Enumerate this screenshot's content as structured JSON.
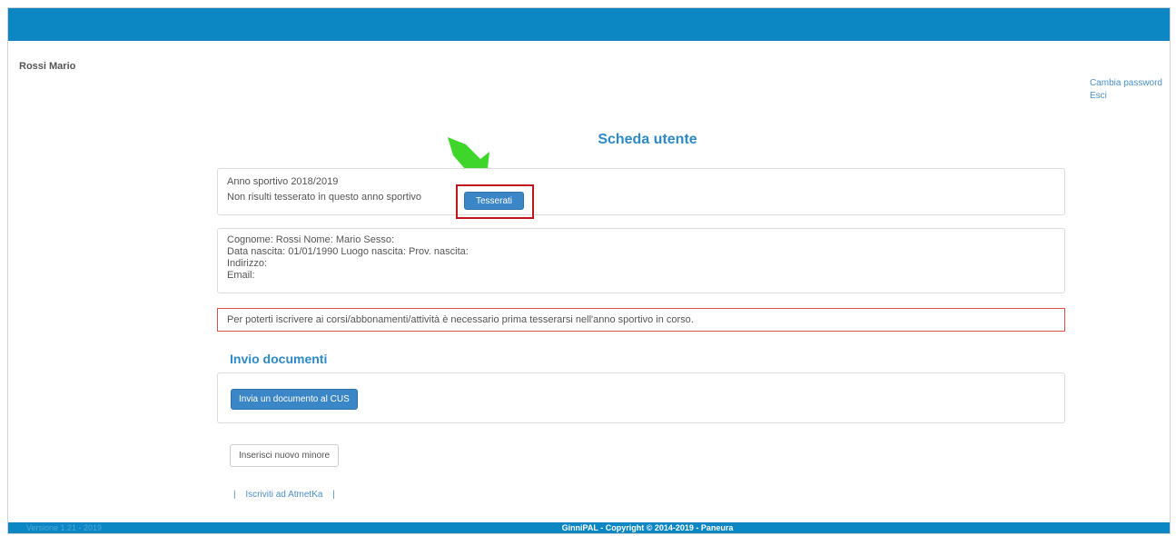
{
  "user": {
    "name": "Rossi Mario"
  },
  "top_links": {
    "change_password": "Cambia password",
    "logout": "Esci"
  },
  "page": {
    "title": "Scheda utente"
  },
  "season": {
    "year_label": "Anno sportivo 2018/2019",
    "status_text": "Non risulti tesserato in questo anno sportivo",
    "register_button": "Tesserati"
  },
  "profile": {
    "line1": "Cognome: Rossi   Nome: Mario   Sesso:",
    "line2": "Data nascita: 01/01/1990   Luogo nascita:   Prov. nascita:",
    "line3": "Indirizzo:",
    "line4": "Email:"
  },
  "alert": {
    "text": "Per poterti iscrivere ai corsi/abbonamenti/attività è necessario prima tesserarsi nell'anno sportivo in corso."
  },
  "documents": {
    "title": "Invio documenti",
    "send_button": "Invia un documento al CUS"
  },
  "minor": {
    "add_button": "Inserisci nuovo minore"
  },
  "links": {
    "sep_left": "|",
    "atlhetika": "Iscriviti ad AtmetKa",
    "sep_right": "|"
  },
  "footer": {
    "version": "Versione 1.21 - 2019",
    "copyright": "GinniPAL - Copyright © 2014-2019 - Paneura"
  },
  "colors": {
    "accent": "#0c87c4",
    "primary_button": "#3a86c6",
    "highlight_border": "#c0151b",
    "arrow": "#3fd62b"
  }
}
